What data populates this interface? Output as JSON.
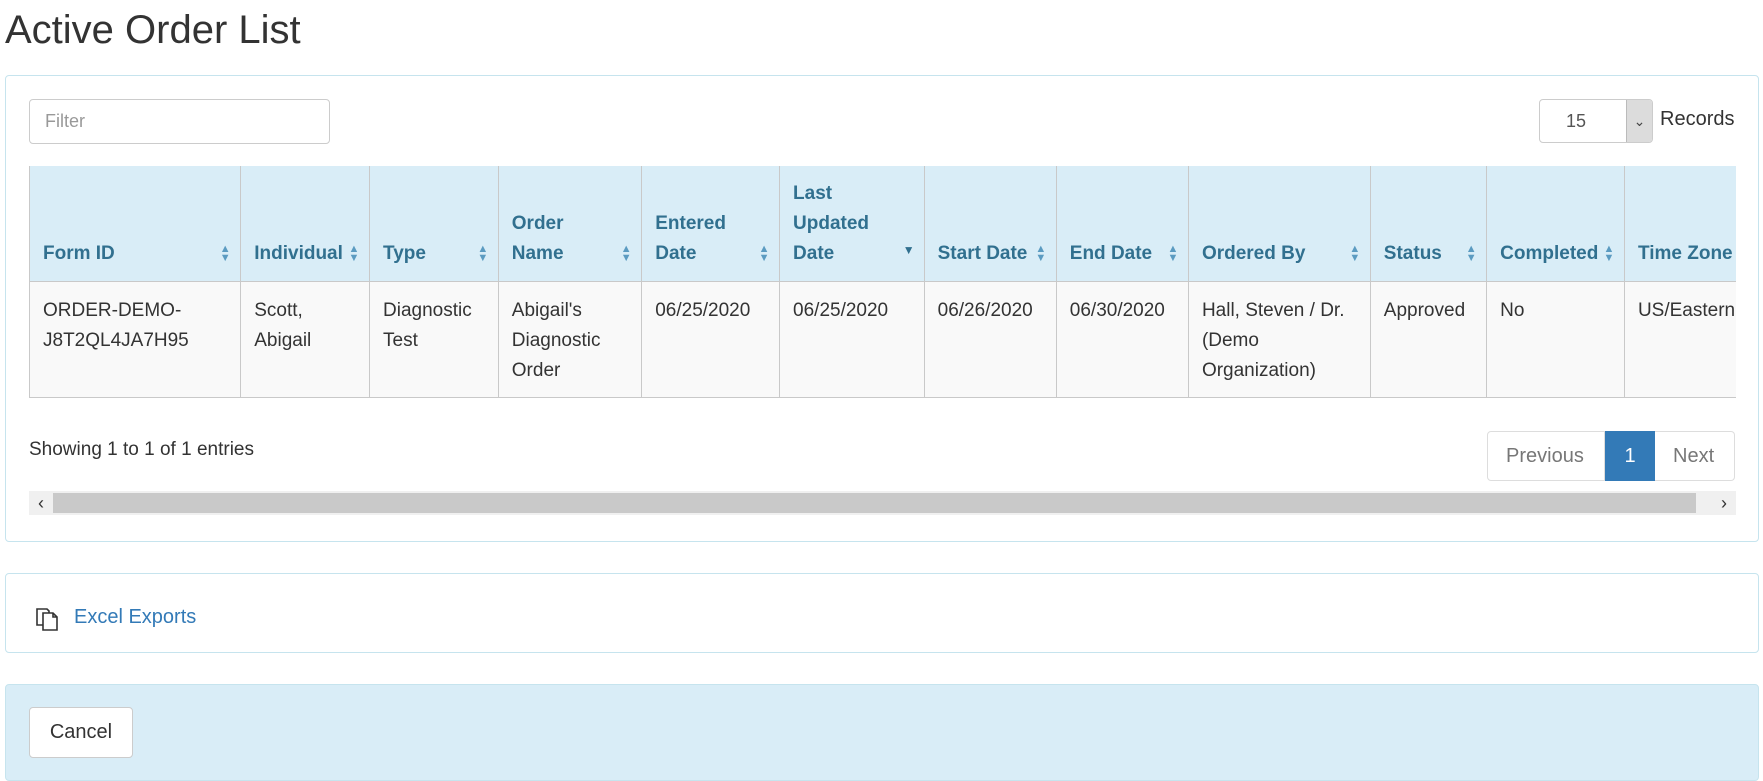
{
  "page": {
    "title": "Active Order List"
  },
  "filter": {
    "placeholder": "Filter",
    "value": ""
  },
  "records": {
    "selected": "15",
    "label": "Records"
  },
  "table": {
    "columns": [
      {
        "label": "Form ID",
        "sort": "both"
      },
      {
        "label": "Individual",
        "sort": "both"
      },
      {
        "label": "Type",
        "sort": "both"
      },
      {
        "label": "Order Name",
        "sort": "both"
      },
      {
        "label": "Entered Date",
        "sort": "both"
      },
      {
        "label": "Last Updated Date",
        "sort": "desc"
      },
      {
        "label": "Start Date",
        "sort": "both"
      },
      {
        "label": "End Date",
        "sort": "both"
      },
      {
        "label": "Ordered By",
        "sort": "both"
      },
      {
        "label": "Status",
        "sort": "both"
      },
      {
        "label": "Completed",
        "sort": "both"
      },
      {
        "label": "Time Zone",
        "sort": "both"
      }
    ],
    "rows": [
      [
        "ORDER-DEMO-J8T2QL4JA7H95",
        "Scott, Abigail",
        "Diagnostic Test",
        "Abigail's Diagnostic Order",
        "06/25/2020",
        "06/25/2020",
        "06/26/2020",
        "06/30/2020",
        "Hall, Steven / Dr. (Demo Organization)",
        "Approved",
        "No",
        "US/Eastern"
      ]
    ]
  },
  "info": {
    "showing": "Showing 1 to 1 of 1 entries"
  },
  "pagination": {
    "previous": "Previous",
    "current": "1",
    "next": "Next"
  },
  "exports": {
    "label": "Excel Exports",
    "icon": "copy-icon"
  },
  "footer": {
    "cancel_label": "Cancel"
  },
  "colors": {
    "header_bg": "#d9edf7",
    "header_text": "#31708f",
    "link": "#337ab7",
    "active_page": "#337ab7"
  }
}
